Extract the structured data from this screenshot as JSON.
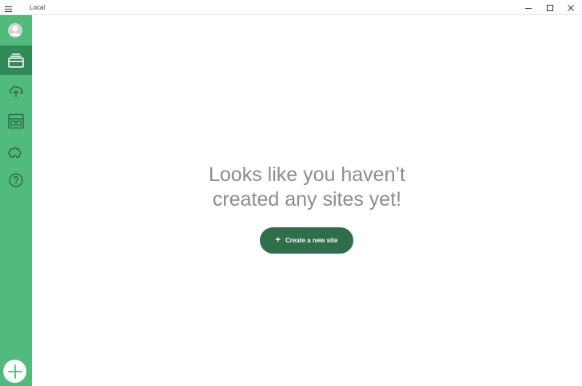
{
  "app": {
    "title": "Local"
  },
  "titlebar": {
    "menu_icon": "hamburger-icon",
    "controls": [
      "minimize-icon",
      "maximize-icon",
      "close-icon"
    ]
  },
  "sidebar": {
    "items": [
      {
        "name": "avatar",
        "icon": "user-avatar-icon"
      },
      {
        "name": "sites",
        "icon": "sites-stack-icon",
        "active": true
      },
      {
        "name": "connect",
        "icon": "cloud-upload-icon"
      },
      {
        "name": "blueprints",
        "icon": "layout-icon"
      },
      {
        "name": "addons",
        "icon": "puzzle-icon"
      },
      {
        "name": "help",
        "icon": "help-icon"
      }
    ],
    "add_button_icon": "plus-icon"
  },
  "main": {
    "empty_message": "Looks like you haven’t\ncreated any sites yet!",
    "create_button": {
      "plus": "+",
      "label": "Create a new site"
    }
  },
  "colors": {
    "sidebar": "#51bb7b",
    "sidebar_active": "#2f8a58",
    "button": "#2e6e4b",
    "text_muted": "#8c8c8c"
  }
}
